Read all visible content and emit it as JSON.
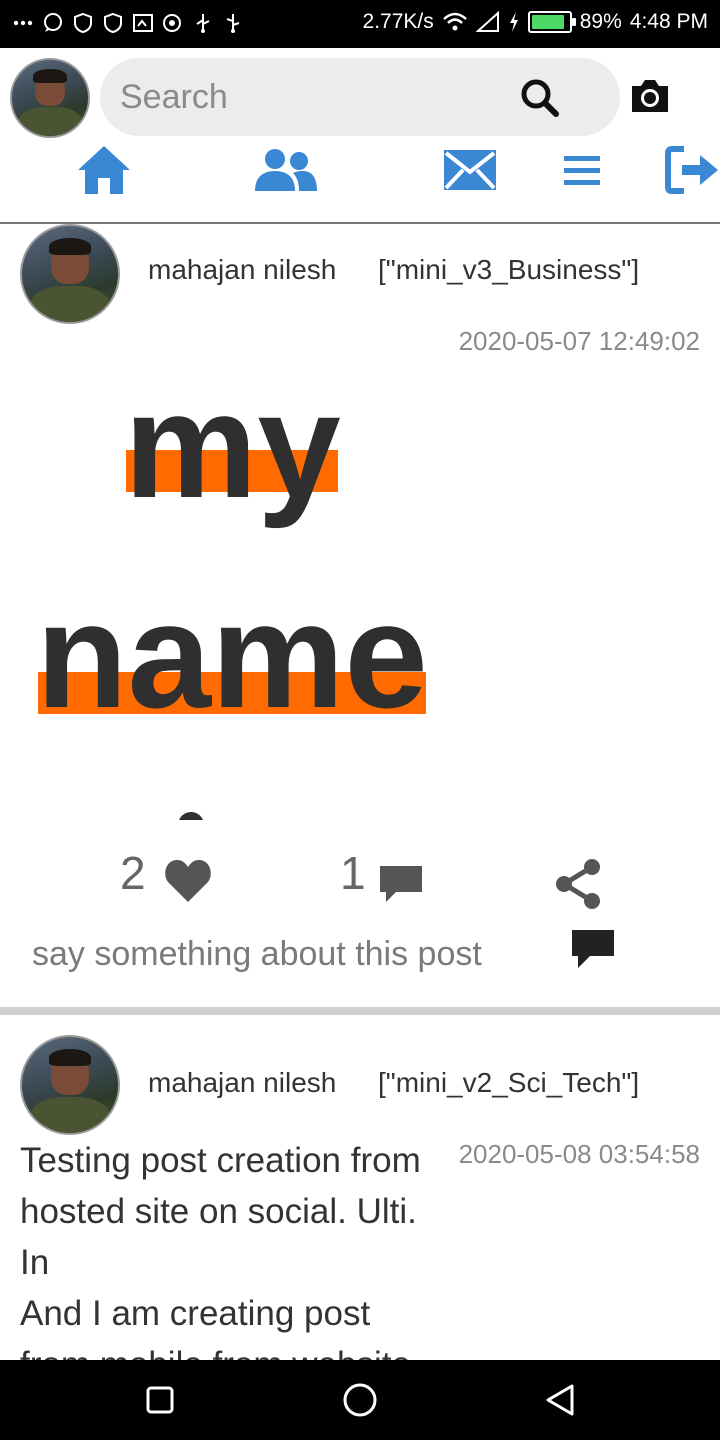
{
  "status_bar": {
    "speed": "2.77K/s",
    "battery": "89%",
    "battery_level": 0.89,
    "time": "4:48 PM"
  },
  "header": {
    "search_placeholder": "Search",
    "nav": [
      {
        "name": "home-icon",
        "label": "Home"
      },
      {
        "name": "users-icon",
        "label": "Friends"
      },
      {
        "name": "mail-icon",
        "label": "Messages"
      },
      {
        "name": "menu-icon",
        "label": "Menu"
      },
      {
        "name": "logout-icon",
        "label": "Logout"
      }
    ],
    "accent_color": "#3a87d4"
  },
  "posts": [
    {
      "author": "mahajan nilesh",
      "category": "[\"mini_v3_Business\"]",
      "timestamp": "2020-05-07 12:49:02",
      "image_words": [
        "my",
        "name"
      ],
      "likes": "2",
      "comments": "1",
      "comment_placeholder": "say something about this post"
    },
    {
      "author": "mahajan nilesh",
      "category": "[\"mini_v2_Sci_Tech\"]",
      "timestamp": "2020-05-08 03:54:58",
      "body_lines": [
        "Testing post creation from",
        "hosted site on social. Ulti.",
        "In",
        "And I am creating post",
        "from mobile from website"
      ]
    }
  ],
  "colors": {
    "highlight": "#ff6b00",
    "icon_gray": "#555555"
  }
}
